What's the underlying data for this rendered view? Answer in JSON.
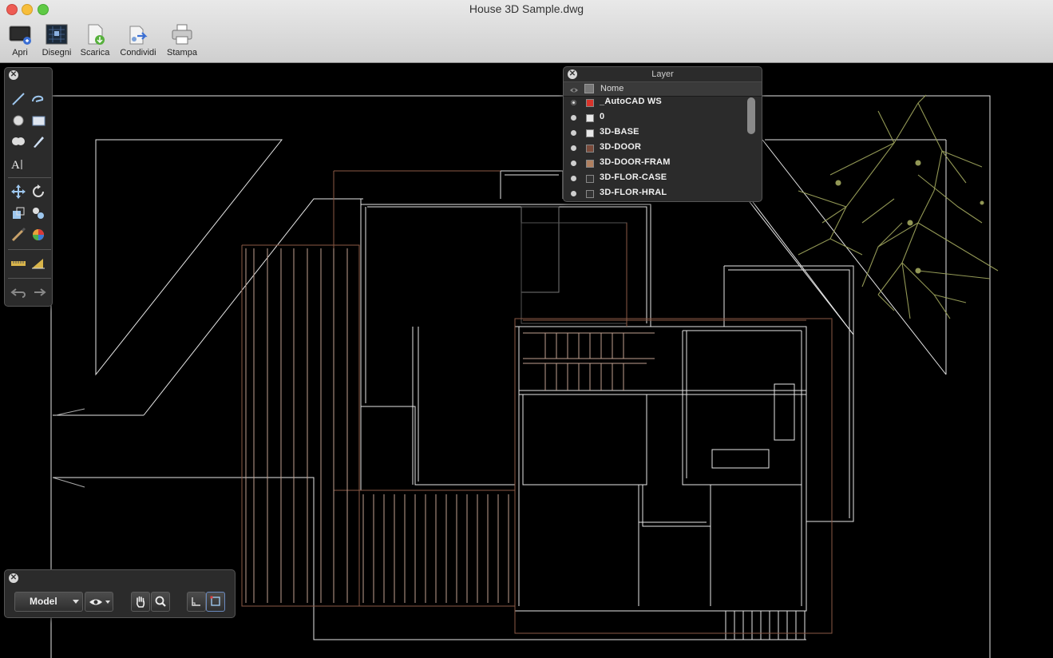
{
  "window": {
    "title": "House 3D Sample.dwg"
  },
  "toolbar": {
    "apri": "Apri",
    "disegni": "Disegni",
    "scarica": "Scarica",
    "condividi": "Condividi",
    "stampa": "Stampa"
  },
  "layer_panel": {
    "title": "Layer",
    "column_name": "Nome",
    "layers": [
      {
        "name": "_AutoCAD WS",
        "color": "#d9342b"
      },
      {
        "name": "0",
        "color": "#e8e8e8"
      },
      {
        "name": "3D-BASE",
        "color": "#e8e8e8"
      },
      {
        "name": "3D-DOOR",
        "color": "#7a4a3a"
      },
      {
        "name": "3D-DOOR-FRAM",
        "color": "#b08060"
      },
      {
        "name": "3D-FLOR-CASE",
        "color": "#333333"
      },
      {
        "name": "3D-FLOR-HRAL",
        "color": "#333333"
      }
    ]
  },
  "bottom_palette": {
    "model_label": "Model"
  },
  "colors": {
    "line_white": "#e6e6e6",
    "line_brown": "#8b5a46",
    "tree": "#9aa05a",
    "canvas_bg": "#000000"
  },
  "icons": [
    "line-icon",
    "polyline-icon",
    "circle-icon",
    "rectangle-icon",
    "cloud-icon",
    "pen-icon",
    "text-icon",
    "move-icon",
    "rotate-icon",
    "scale-icon",
    "copy-icon",
    "brush-icon",
    "color-wheel-icon",
    "measure-icon",
    "area-icon",
    "undo-icon",
    "redo-icon",
    "eye-icon",
    "hand-icon",
    "zoom-icon"
  ]
}
